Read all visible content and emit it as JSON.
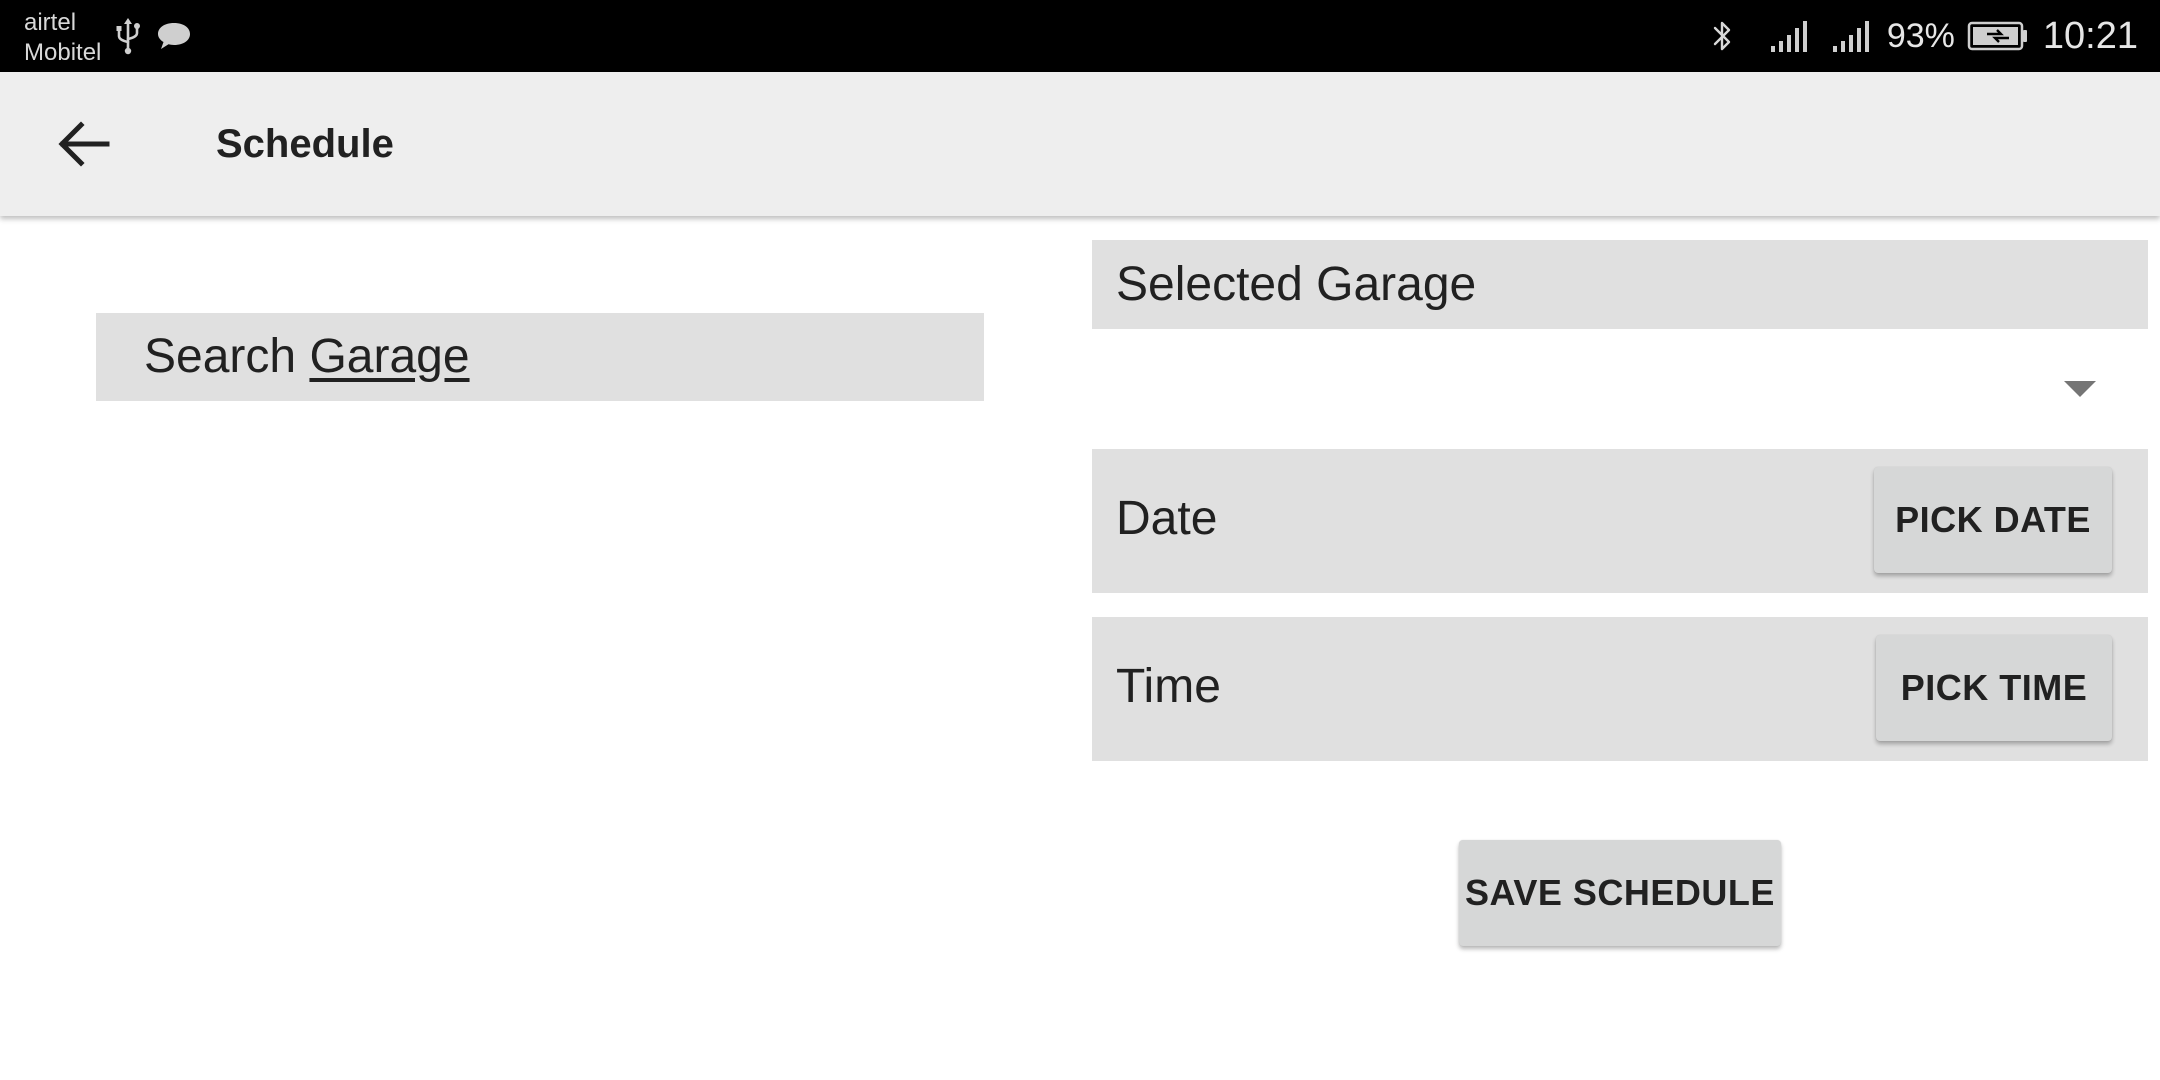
{
  "status_bar": {
    "carrier_line1": "airtel",
    "carrier_line2": "Mobitel",
    "battery_percent": "93%",
    "clock": "10:21",
    "icons": [
      "usb-icon",
      "chat-icon",
      "bluetooth-icon",
      "signal-icon",
      "signal-icon",
      "battery-charging-icon"
    ]
  },
  "app_bar": {
    "title": "Schedule",
    "back_icon": "back-arrow-icon"
  },
  "search": {
    "prefix": "Search",
    "suffix": "Garage"
  },
  "selected_garage": {
    "label": "Selected Garage"
  },
  "garage_spinner": {
    "selected_value": "",
    "icon": "dropdown-triangle-icon"
  },
  "date": {
    "label": "Date",
    "button_label": "PICK DATE"
  },
  "time": {
    "label": "Time",
    "button_label": "PICK TIME"
  },
  "save_button_label": "SAVE SCHEDULE",
  "colors": {
    "status_bar_bg": "#000000",
    "app_bar_bg": "#eeeeee",
    "field_bg": "#e0e0e0",
    "button_bg": "#d6d7d7",
    "text": "#212121"
  }
}
